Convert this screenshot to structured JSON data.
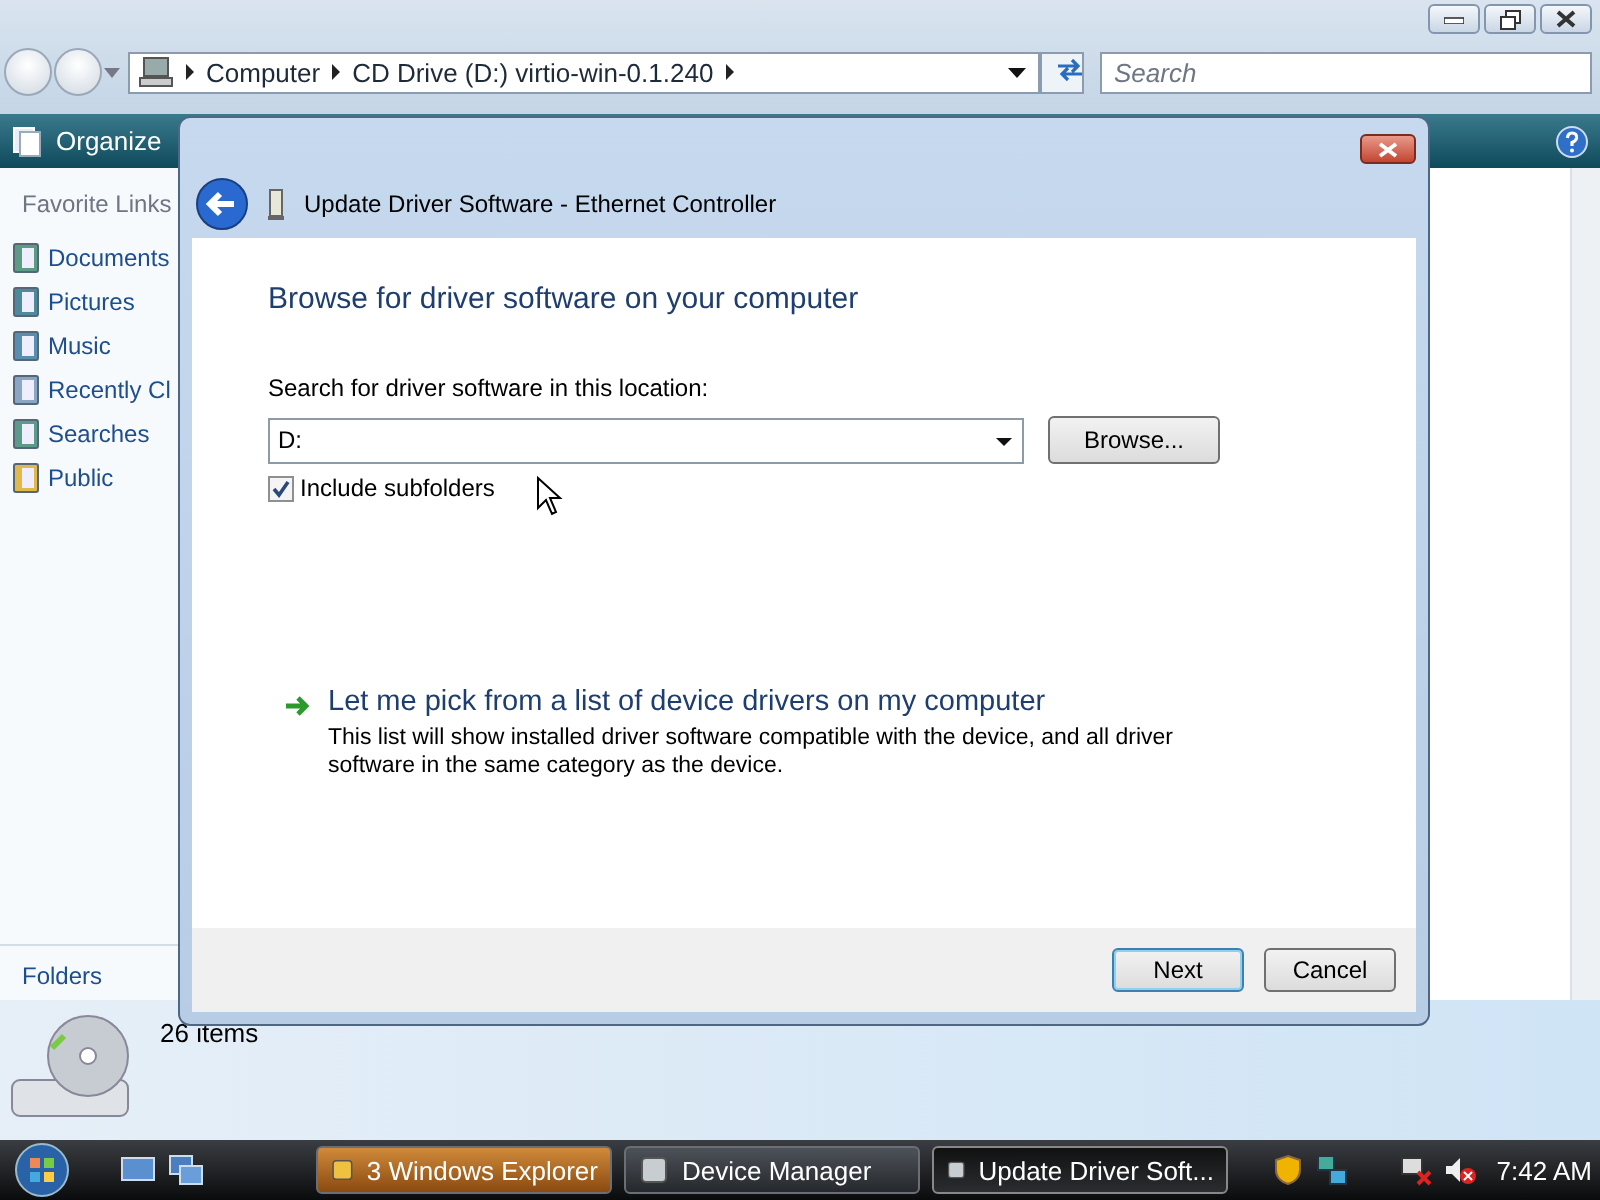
{
  "explorer": {
    "address_bar": {
      "crumbs": [
        "Computer",
        "CD Drive (D:) virtio-win-0.1.240"
      ]
    },
    "search": {
      "placeholder": "Search"
    },
    "toolbar": {
      "organize": "Organize"
    },
    "favorite_links": {
      "title": "Favorite Links",
      "items": [
        "Documents",
        "Pictures",
        "Music",
        "Recently Cl",
        "Searches",
        "Public"
      ]
    },
    "folders": "Folders",
    "details": {
      "item_count": "26 items"
    }
  },
  "dialog": {
    "title": "Update Driver Software - Ethernet Controller",
    "heading": "Browse for driver software on your computer",
    "location_label": "Search for driver software in this location:",
    "location": {
      "value": "D:"
    },
    "browse": "Browse...",
    "include_subfolders": {
      "label": "Include subfolders",
      "checked": true
    },
    "pick_link": {
      "title": "Let me pick from a list of device drivers on my computer",
      "description": "This list will show installed driver software compatible with the device, and all driver software in the same category as the device."
    },
    "buttons": [
      {
        "label": "Next",
        "default": true
      },
      {
        "label": "Cancel",
        "default": false
      }
    ]
  },
  "taskbar": {
    "buttons": [
      {
        "label": "3 Windows Explorer",
        "flashing": true,
        "selected": false
      },
      {
        "label": "Device Manager",
        "flashing": false,
        "selected": false
      },
      {
        "label": "Update Driver Soft...",
        "flashing": false,
        "selected": true
      }
    ],
    "clock": "7:42 AM"
  }
}
